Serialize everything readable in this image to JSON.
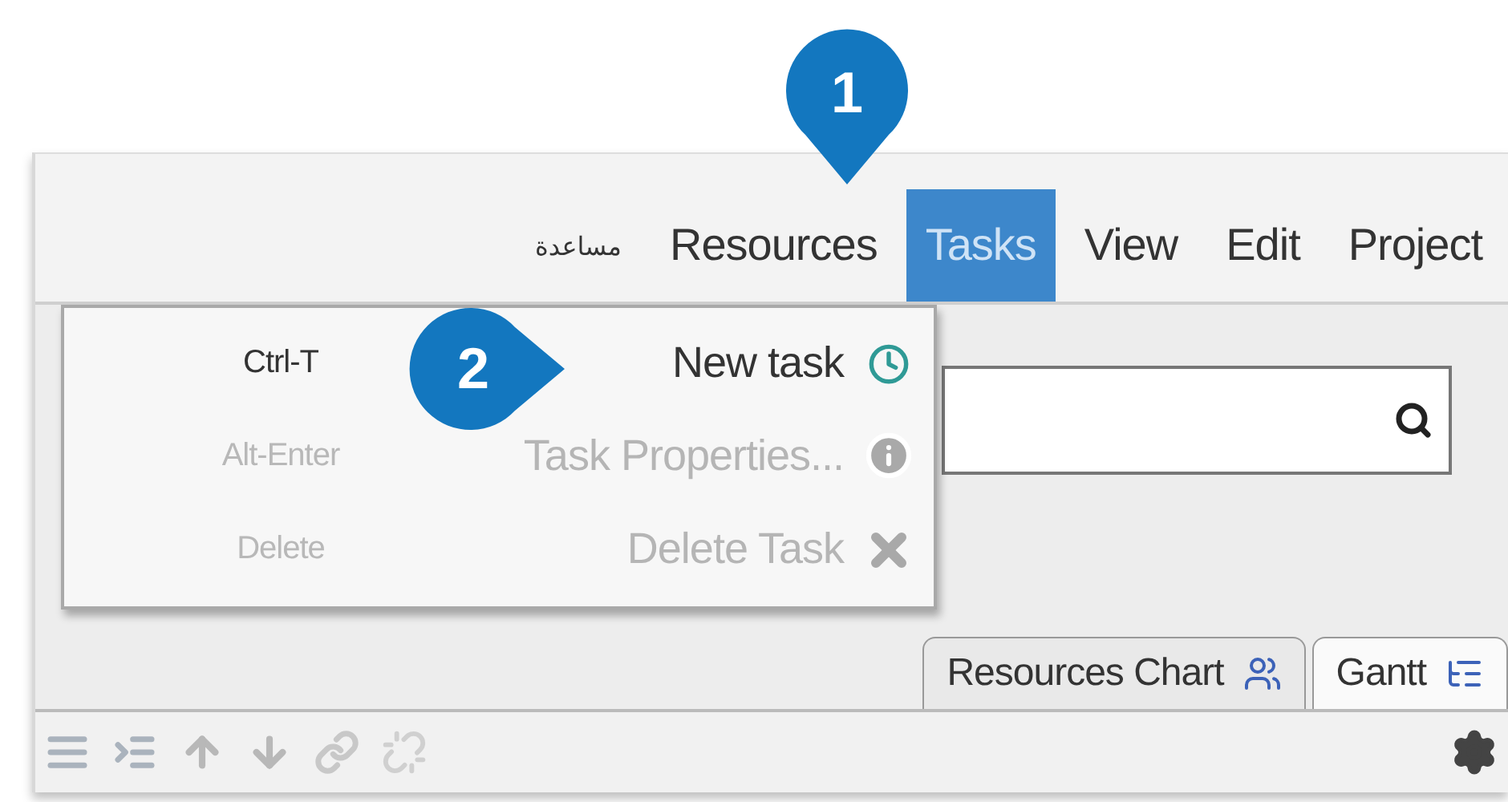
{
  "callouts": [
    {
      "number": "1",
      "kind": "down"
    },
    {
      "number": "2",
      "kind": "right"
    }
  ],
  "menu_bar": {
    "items": [
      {
        "label": "مساعدة",
        "selected": false
      },
      {
        "label": "Resources",
        "selected": false
      },
      {
        "label": "Tasks",
        "selected": true
      },
      {
        "label": "View",
        "selected": false
      },
      {
        "label": "Edit",
        "selected": false
      },
      {
        "label": "Project",
        "selected": false
      }
    ]
  },
  "tasks_menu": {
    "items": [
      {
        "shortcut": "Ctrl-T",
        "label": "New task",
        "disabled": false,
        "kind": "clock"
      },
      {
        "shortcut": "Alt-Enter",
        "label": "Task Properties...",
        "disabled": true,
        "kind": "info"
      },
      {
        "shortcut": "Delete",
        "label": "Delete Task",
        "disabled": true,
        "kind": "delete"
      }
    ]
  },
  "tabs": [
    {
      "label": "Resources Chart",
      "selected": false,
      "kind": "chart"
    },
    {
      "label": "Gantt",
      "selected": true,
      "kind": "gantt"
    }
  ]
}
